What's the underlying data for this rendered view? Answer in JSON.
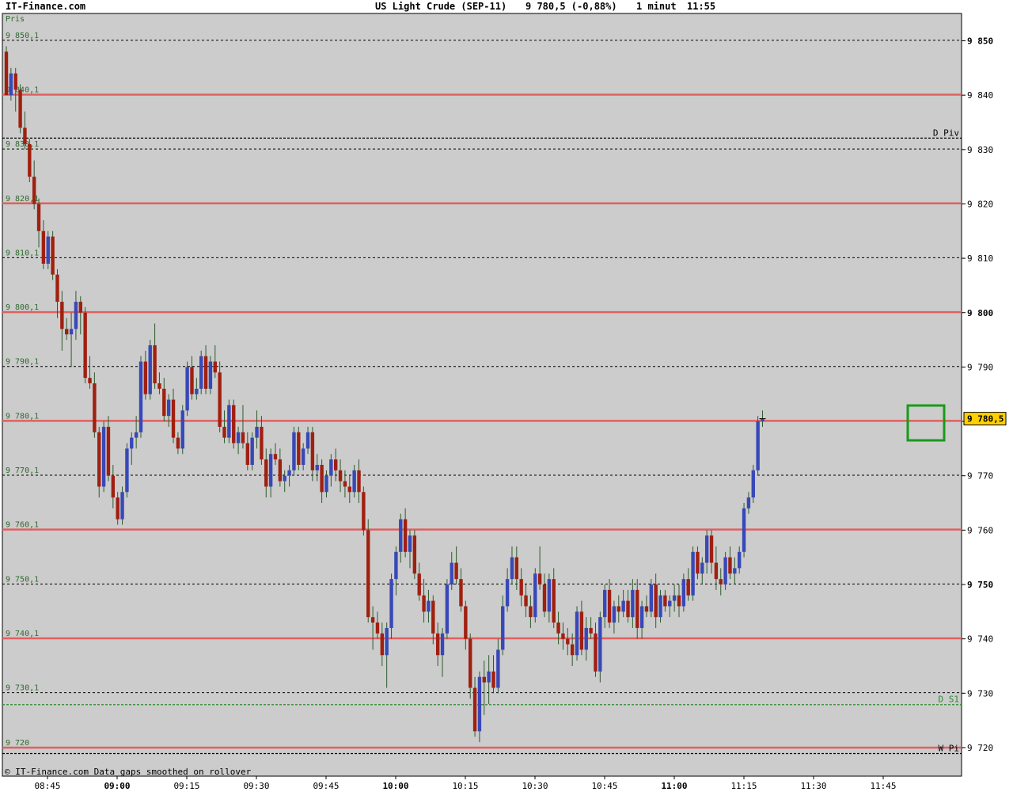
{
  "header": {
    "site": "IT-Finance.com",
    "instrument": "US Light Crude (SEP-11)",
    "quote": "9 780,5 (-0,88%)",
    "interval": "1 minut",
    "time": "11:55"
  },
  "axis_label": "Pris",
  "footer": "© IT-Finance.com Data gaps smoothed on rollover",
  "colors": {
    "plot_bg": "#cccccc",
    "up_candle": "#3848b8",
    "down_candle": "#a02010",
    "wick": "#2f5a2f",
    "red_level": "#e06060",
    "pivot": "#000000",
    "support": "#2e8b2e",
    "highlight_box": "#1a9a1a",
    "last_price_tag": "#ffd000"
  },
  "chart_data": {
    "type": "candlestick",
    "title": "US Light Crude (SEP-11)",
    "interval": "1 minut",
    "ylim": [
      9717,
      9856
    ],
    "y_ticks": [
      {
        "value": 9850,
        "label": "9 850",
        "bold": true
      },
      {
        "value": 9840,
        "label": "9 840",
        "bold": false
      },
      {
        "value": 9830,
        "label": "9 830",
        "bold": false
      },
      {
        "value": 9820,
        "label": "9 820",
        "bold": false
      },
      {
        "value": 9810,
        "label": "9 810",
        "bold": false
      },
      {
        "value": 9800,
        "label": "9 800",
        "bold": true
      },
      {
        "value": 9790,
        "label": "9 790",
        "bold": false
      },
      {
        "value": 9780,
        "label": "9 780",
        "bold": false
      },
      {
        "value": 9770,
        "label": "9 770",
        "bold": false
      },
      {
        "value": 9760,
        "label": "9 760",
        "bold": false
      },
      {
        "value": 9750,
        "label": "9 750",
        "bold": true
      },
      {
        "value": 9740,
        "label": "9 740",
        "bold": false
      },
      {
        "value": 9730,
        "label": "9 730",
        "bold": false
      },
      {
        "value": 9720,
        "label": "9 720",
        "bold": false
      }
    ],
    "x_ticks": [
      {
        "label": "08:45",
        "bold": false
      },
      {
        "label": "09:00",
        "bold": true
      },
      {
        "label": "09:15",
        "bold": false
      },
      {
        "label": "09:30",
        "bold": false
      },
      {
        "label": "09:45",
        "bold": false
      },
      {
        "label": "10:00",
        "bold": true
      },
      {
        "label": "10:15",
        "bold": false
      },
      {
        "label": "10:30",
        "bold": false
      },
      {
        "label": "10:45",
        "bold": false
      },
      {
        "label": "11:00",
        "bold": true
      },
      {
        "label": "11:15",
        "bold": false
      },
      {
        "label": "11:30",
        "bold": false
      },
      {
        "label": "11:45",
        "bold": false
      }
    ],
    "level_lines": [
      {
        "value": 9850.1,
        "label": "9 850,1",
        "style": "dotted"
      },
      {
        "value": 9840.1,
        "label": "9 840,1",
        "style": "red"
      },
      {
        "value": 9830.1,
        "label": "9 830,1",
        "style": "dotted"
      },
      {
        "value": 9820.1,
        "label": "9 820,1",
        "style": "red"
      },
      {
        "value": 9810.1,
        "label": "9 810,1",
        "style": "dotted"
      },
      {
        "value": 9800.1,
        "label": "9 800,1",
        "style": "red"
      },
      {
        "value": 9790.1,
        "label": "9 790,1",
        "style": "dotted"
      },
      {
        "value": 9780.1,
        "label": "9 780,1",
        "style": "red"
      },
      {
        "value": 9770.1,
        "label": "9 770,1",
        "style": "dotted"
      },
      {
        "value": 9760.1,
        "label": "9 760,1",
        "style": "red"
      },
      {
        "value": 9750.1,
        "label": "9 750,1",
        "style": "dotted"
      },
      {
        "value": 9740.1,
        "label": "9 740,1",
        "style": "red"
      },
      {
        "value": 9730.1,
        "label": "9 730,1",
        "style": "dotted"
      },
      {
        "value": 9720,
        "label": "9 720",
        "style": "red"
      }
    ],
    "pivots": [
      {
        "name": "D Piv",
        "value": 9832.1,
        "color": "#000000"
      },
      {
        "name": "D S1",
        "value": 9727.9,
        "color": "#2e8b2e"
      },
      {
        "name": "W Pi",
        "value": 9718.9,
        "color": "#000000"
      }
    ],
    "last_price": {
      "value": 9780.5,
      "label": "9 780,5"
    },
    "candles": [
      [
        9848,
        9849,
        9840,
        9840
      ],
      [
        9840,
        9845,
        9839,
        9844
      ],
      [
        9844,
        9845,
        9837,
        9841
      ],
      [
        9841,
        9842,
        9833,
        9834
      ],
      [
        9834,
        9837,
        9830,
        9831
      ],
      [
        9831,
        9832,
        9824,
        9825
      ],
      [
        9825,
        9828,
        9819,
        9820
      ],
      [
        9820,
        9821,
        9812,
        9815
      ],
      [
        9815,
        9817,
        9808,
        9809
      ],
      [
        9809,
        9815,
        9808,
        9814
      ],
      [
        9814,
        9815,
        9806,
        9807
      ],
      [
        9807,
        9808,
        9799,
        9802
      ],
      [
        9802,
        9804,
        9793,
        9797
      ],
      [
        9797,
        9799,
        9795,
        9796
      ],
      [
        9796,
        9800,
        9790,
        9797
      ],
      [
        9797,
        9804,
        9795,
        9802
      ],
      [
        9802,
        9803,
        9796,
        9800
      ],
      [
        9800,
        9801,
        9787,
        9788
      ],
      [
        9788,
        9792,
        9786,
        9787
      ],
      [
        9787,
        9789,
        9777,
        9778
      ],
      [
        9778,
        9779,
        9766,
        9768
      ],
      [
        9768,
        9780,
        9767,
        9779
      ],
      [
        9779,
        9781,
        9769,
        9770
      ],
      [
        9770,
        9772,
        9764,
        9766
      ],
      [
        9766,
        9767,
        9761,
        9762
      ],
      [
        9762,
        9768,
        9761,
        9767
      ],
      [
        9767,
        9776,
        9766,
        9775
      ],
      [
        9775,
        9778,
        9772,
        9777
      ],
      [
        9777,
        9781,
        9775,
        9778
      ],
      [
        9778,
        9792,
        9777,
        9791
      ],
      [
        9791,
        9793,
        9784,
        9785
      ],
      [
        9785,
        9795,
        9784,
        9794
      ],
      [
        9794,
        9798,
        9786,
        9787
      ],
      [
        9787,
        9789,
        9785,
        9786
      ],
      [
        9786,
        9788,
        9780,
        9781
      ],
      [
        9781,
        9785,
        9779,
        9784
      ],
      [
        9784,
        9786,
        9776,
        9777
      ],
      [
        9777,
        9778,
        9774,
        9775
      ],
      [
        9775,
        9783,
        9774,
        9782
      ],
      [
        9782,
        9791,
        9781,
        9790
      ],
      [
        9790,
        9792,
        9784,
        9785
      ],
      [
        9785,
        9788,
        9784,
        9786
      ],
      [
        9786,
        9793,
        9785,
        9792
      ],
      [
        9792,
        9794,
        9785,
        9786
      ],
      [
        9786,
        9792,
        9785,
        9791
      ],
      [
        9791,
        9794,
        9788,
        9789
      ],
      [
        9789,
        9791,
        9778,
        9779
      ],
      [
        9779,
        9782,
        9776,
        9777
      ],
      [
        9777,
        9784,
        9776,
        9783
      ],
      [
        9783,
        9784,
        9775,
        9776
      ],
      [
        9776,
        9779,
        9774,
        9778
      ],
      [
        9778,
        9783,
        9775,
        9776
      ],
      [
        9776,
        9778,
        9771,
        9772
      ],
      [
        9772,
        9778,
        9771,
        9777
      ],
      [
        9777,
        9782,
        9775,
        9779
      ],
      [
        9779,
        9781,
        9772,
        9773
      ],
      [
        9773,
        9775,
        9766,
        9768
      ],
      [
        9768,
        9775,
        9766,
        9774
      ],
      [
        9774,
        9776,
        9772,
        9773
      ],
      [
        9773,
        9775,
        9768,
        9769
      ],
      [
        9769,
        9771,
        9767,
        9770
      ],
      [
        9770,
        9772,
        9768,
        9771
      ],
      [
        9771,
        9779,
        9770,
        9778
      ],
      [
        9778,
        9779,
        9771,
        9772
      ],
      [
        9772,
        9776,
        9771,
        9775
      ],
      [
        9775,
        9779,
        9774,
        9778
      ],
      [
        9778,
        9779,
        9769,
        9771
      ],
      [
        9771,
        9774,
        9769,
        9772
      ],
      [
        9772,
        9773,
        9765,
        9767
      ],
      [
        9767,
        9771,
        9766,
        9770
      ],
      [
        9770,
        9774,
        9768,
        9773
      ],
      [
        9773,
        9775,
        9769,
        9771
      ],
      [
        9771,
        9773,
        9767,
        9769
      ],
      [
        9769,
        9771,
        9766,
        9768
      ],
      [
        9768,
        9770,
        9765,
        9767
      ],
      [
        9767,
        9772,
        9766,
        9771
      ],
      [
        9771,
        9773,
        9765,
        9767
      ],
      [
        9767,
        9768,
        9759,
        9760
      ],
      [
        9760,
        9762,
        9743,
        9744
      ],
      [
        9744,
        9746,
        9738,
        9743
      ],
      [
        9743,
        9745,
        9740,
        9741
      ],
      [
        9741,
        9743,
        9735,
        9737
      ],
      [
        9737,
        9743,
        9731,
        9742
      ],
      [
        9742,
        9752,
        9740,
        9751
      ],
      [
        9751,
        9757,
        9748,
        9756
      ],
      [
        9756,
        9763,
        9754,
        9762
      ],
      [
        9762,
        9764,
        9755,
        9756
      ],
      [
        9756,
        9760,
        9753,
        9759
      ],
      [
        9759,
        9760,
        9751,
        9752
      ],
      [
        9752,
        9754,
        9747,
        9748
      ],
      [
        9748,
        9751,
        9743,
        9745
      ],
      [
        9745,
        9749,
        9743,
        9747
      ],
      [
        9747,
        9748,
        9739,
        9741
      ],
      [
        9741,
        9743,
        9735,
        9737
      ],
      [
        9737,
        9742,
        9733,
        9741
      ],
      [
        9741,
        9751,
        9740,
        9750
      ],
      [
        9750,
        9756,
        9749,
        9754
      ],
      [
        9754,
        9757,
        9750,
        9751
      ],
      [
        9751,
        9753,
        9745,
        9746
      ],
      [
        9746,
        9747,
        9738,
        9740
      ],
      [
        9740,
        9741,
        9729,
        9731
      ],
      [
        9731,
        9733,
        9722,
        9723
      ],
      [
        9723,
        9734,
        9721,
        9733
      ],
      [
        9733,
        9736,
        9726,
        9732
      ],
      [
        9732,
        9737,
        9728,
        9734
      ],
      [
        9734,
        9737,
        9730,
        9731
      ],
      [
        9731,
        9740,
        9730,
        9738
      ],
      [
        9738,
        9748,
        9737,
        9746
      ],
      [
        9746,
        9753,
        9745,
        9751
      ],
      [
        9751,
        9757,
        9750,
        9755
      ],
      [
        9755,
        9757,
        9749,
        9751
      ],
      [
        9751,
        9753,
        9746,
        9748
      ],
      [
        9748,
        9750,
        9744,
        9746
      ],
      [
        9746,
        9748,
        9742,
        9744
      ],
      [
        9744,
        9753,
        9743,
        9752
      ],
      [
        9752,
        9757,
        9749,
        9750
      ],
      [
        9750,
        9752,
        9744,
        9745
      ],
      [
        9745,
        9752,
        9743,
        9751
      ],
      [
        9751,
        9753,
        9742,
        9743
      ],
      [
        9743,
        9745,
        9739,
        9741
      ],
      [
        9741,
        9743,
        9738,
        9740
      ],
      [
        9740,
        9742,
        9737,
        9739
      ],
      [
        9739,
        9741,
        9735,
        9737
      ],
      [
        9737,
        9746,
        9736,
        9745
      ],
      [
        9745,
        9747,
        9737,
        9738
      ],
      [
        9738,
        9744,
        9736,
        9742
      ],
      [
        9742,
        9744,
        9740,
        9741
      ],
      [
        9741,
        9743,
        9733,
        9734
      ],
      [
        9734,
        9745,
        9732,
        9744
      ],
      [
        9744,
        9750,
        9742,
        9749
      ],
      [
        9749,
        9751,
        9742,
        9743
      ],
      [
        9743,
        9747,
        9741,
        9746
      ],
      [
        9746,
        9748,
        9743,
        9745
      ],
      [
        9745,
        9749,
        9744,
        9747
      ],
      [
        9747,
        9749,
        9743,
        9744
      ],
      [
        9744,
        9751,
        9742,
        9749
      ],
      [
        9749,
        9751,
        9740,
        9742
      ],
      [
        9742,
        9747,
        9740,
        9746
      ],
      [
        9746,
        9748,
        9744,
        9745
      ],
      [
        9745,
        9751,
        9744,
        9750
      ],
      [
        9750,
        9752,
        9742,
        9744
      ],
      [
        9744,
        9749,
        9743,
        9748
      ],
      [
        9748,
        9749,
        9745,
        9746
      ],
      [
        9746,
        9748,
        9744,
        9747
      ],
      [
        9747,
        9750,
        9745,
        9748
      ],
      [
        9748,
        9750,
        9744,
        9746
      ],
      [
        9746,
        9752,
        9745,
        9751
      ],
      [
        9751,
        9753,
        9747,
        9748
      ],
      [
        9748,
        9757,
        9747,
        9756
      ],
      [
        9756,
        9757,
        9751,
        9752
      ],
      [
        9752,
        9755,
        9750,
        9754
      ],
      [
        9754,
        9760,
        9752,
        9759
      ],
      [
        9759,
        9760,
        9752,
        9754
      ],
      [
        9754,
        9757,
        9749,
        9751
      ],
      [
        9751,
        9753,
        9748,
        9750
      ],
      [
        9750,
        9756,
        9749,
        9755
      ],
      [
        9755,
        9757,
        9751,
        9752
      ],
      [
        9752,
        9755,
        9750,
        9753
      ],
      [
        9753,
        9757,
        9752,
        9756
      ],
      [
        9756,
        9765,
        9755,
        9764
      ],
      [
        9764,
        9767,
        9763,
        9766
      ],
      [
        9766,
        9772,
        9765,
        9771
      ],
      [
        9771,
        9781,
        9770,
        9780
      ],
      [
        9780,
        9782,
        9779,
        9780.5
      ]
    ]
  }
}
